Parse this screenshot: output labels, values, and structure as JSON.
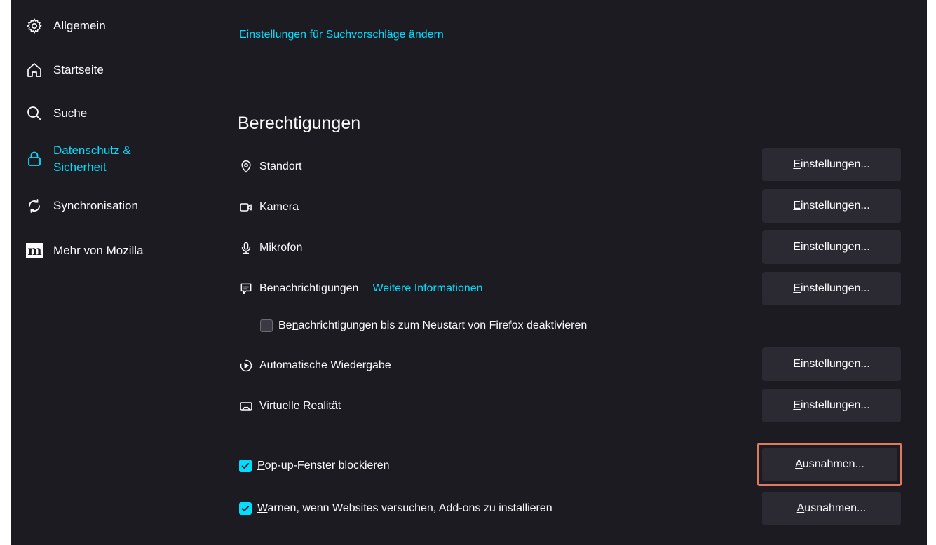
{
  "sidebar": {
    "items": [
      {
        "label": "Allgemein",
        "icon": "gear-icon"
      },
      {
        "label": "Startseite",
        "icon": "home-icon"
      },
      {
        "label": "Suche",
        "icon": "search-icon"
      },
      {
        "label_line1": "Datenschutz &",
        "label_line2": "Sicherheit",
        "icon": "lock-icon",
        "active": true
      },
      {
        "label": "Synchronisation",
        "icon": "sync-icon"
      },
      {
        "label": "Mehr von Mozilla",
        "icon": "mozilla-icon",
        "icon_text": "m"
      }
    ]
  },
  "main": {
    "search_suggestions_link": "Einstellungen für Suchvorschläge ändern",
    "permissions_title": "Berechtigungen",
    "permissions": [
      {
        "label": "Standort",
        "icon": "location-icon",
        "button_pre": "",
        "button_accel": "E",
        "button_post": "instellungen..."
      },
      {
        "label": "Kamera",
        "icon": "camera-icon",
        "button_pre": "",
        "button_accel": "E",
        "button_post": "instellungen..."
      },
      {
        "label": "Mikrofon",
        "icon": "microphone-icon",
        "button_pre": "",
        "button_accel": "E",
        "button_post": "instellungen..."
      },
      {
        "label": "Benachrichtigungen",
        "icon": "notification-icon",
        "more_link": "Weitere Informationen",
        "button_pre": "",
        "button_accel": "E",
        "button_post": "instellungen..."
      },
      {
        "label": "Automatische Wiedergabe",
        "icon": "autoplay-icon",
        "button_pre": "",
        "button_accel": "E",
        "button_post": "instellungen..."
      },
      {
        "label": "Virtuelle Realität",
        "icon": "vr-icon",
        "button_pre": "",
        "button_accel": "E",
        "button_post": "instellungen..."
      }
    ],
    "pause_notifications": {
      "pre": "Be",
      "accel": "n",
      "post": "achrichtigungen bis zum Neustart von Firefox deaktivieren",
      "checked": false
    },
    "block_popups": {
      "pre": "",
      "accel": "P",
      "post": "op-up-Fenster blockieren",
      "checked": true,
      "button_pre": "",
      "button_accel": "A",
      "button_post": "usnahmen..."
    },
    "warn_addons": {
      "pre": "",
      "accel": "W",
      "post": "arnen, wenn Websites versuchen, Add-ons zu installieren",
      "checked": true,
      "button_pre": "",
      "button_accel": "A",
      "button_post": "usnahmen..."
    }
  },
  "colors": {
    "background": "#1c1b22",
    "accent": "#00ddff",
    "button": "#2b2a33",
    "highlight": "#e07a5f"
  }
}
